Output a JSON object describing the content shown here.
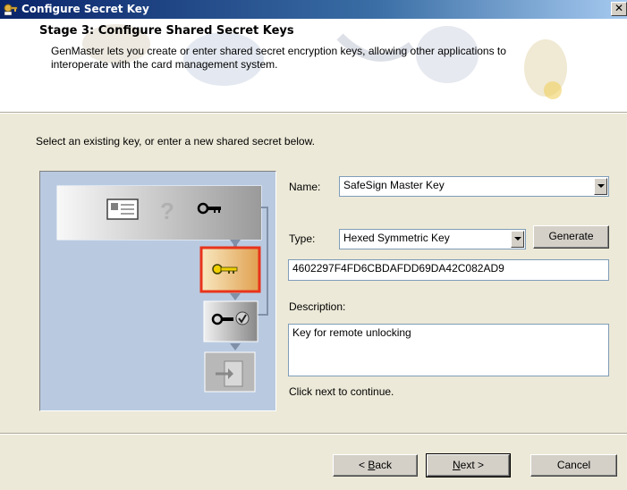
{
  "window": {
    "title": "Configure Secret Key",
    "close_glyph": "✕"
  },
  "header": {
    "title": "Stage 3: Configure Shared Secret Keys",
    "description_line1": "GenMaster lets you create or enter shared secret encryption keys, allowing other applications to",
    "description_line2": "interoperate with the card management system."
  },
  "instruction": "Select an existing key, or enter a new shared secret below.",
  "form": {
    "name_label": "Name:",
    "name_value": "SafeSign Master Key",
    "type_label": "Type:",
    "type_value": "Hexed Symmetric Key",
    "generate_label": "Generate",
    "key_value": "4602297F4FD6CBDAFDD69DA42C082AD9",
    "description_label": "Description:",
    "description_value": "Key for remote unlocking",
    "hint": "Click next to continue."
  },
  "buttons": {
    "back_prefix": "< ",
    "back_accel": "B",
    "back_rest": "ack",
    "next_accel": "N",
    "next_rest": "ext >",
    "cancel": "Cancel"
  },
  "colors": {
    "title_bar": "#0a246a",
    "dialog_bg": "#ece9d8",
    "panel_bg": "#b9cae0",
    "highlight_border": "#e8341c",
    "highlight_fill": "#f0b060"
  },
  "icons": {
    "window": "key-window-icon",
    "card": "id-card-icon",
    "question": "question-mark-icon",
    "key": "key-icon",
    "key_check": "key-check-icon",
    "exit": "door-exit-icon"
  }
}
